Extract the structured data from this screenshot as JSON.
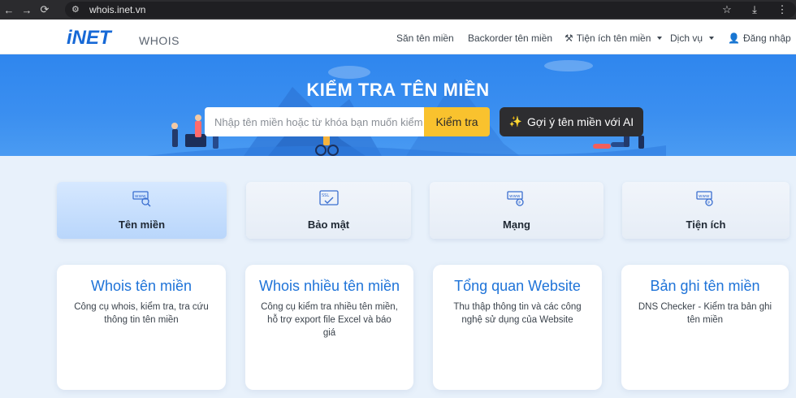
{
  "browser": {
    "url": "whois.inet.vn",
    "back_icon": "arrow-left-icon",
    "forward_icon": "arrow-right-icon",
    "reload_icon": "reload-icon",
    "star_icon": "star-icon",
    "download_icon": "download-icon",
    "menu_icon": "kebab-menu-icon"
  },
  "header": {
    "logo": "iNET",
    "logo_sub": "WHOIS",
    "nav": {
      "san_ten_mien": "Săn tên miền",
      "backorder": "Backorder tên miền",
      "tien_ich": "Tiện ích tên miền",
      "dich_vu": "Dịch vụ",
      "dang_nhap": "Đăng nhập"
    }
  },
  "banner": {
    "title": "KIỂM TRA TÊN MIỀN",
    "search_placeholder": "Nhập tên miền hoặc từ khóa bạn muốn kiểm tra",
    "search_button": "Kiểm tra",
    "ai_button": "Gợi ý tên miền với AI"
  },
  "categories": [
    {
      "label": "Tên miền",
      "icon": "www-search-icon",
      "active": true
    },
    {
      "label": "Bảo mật",
      "icon": "ssl-icon",
      "active": false
    },
    {
      "label": "Mạng",
      "icon": "www-ip-icon",
      "active": false
    },
    {
      "label": "Tiện ích",
      "icon": "www-ip-icon",
      "active": false
    }
  ],
  "cards": [
    {
      "title": "Whois tên miền",
      "desc": "Công cụ whois, kiểm tra, tra cứu thông tin tên miền"
    },
    {
      "title": "Whois nhiều tên miền",
      "desc": "Công cụ kiểm tra nhiều tên miền, hỗ trợ export file Excel và báo giá"
    },
    {
      "title": "Tổng quan Website",
      "desc": "Thu thập thông tin và các công nghệ sử dụng của Website"
    },
    {
      "title": "Bản ghi tên miền",
      "desc": "DNS Checker - Kiểm tra bản ghi tên miền"
    }
  ],
  "colors": {
    "brand_blue": "#1769d6",
    "banner_blue": "#2f86ee",
    "search_yellow": "#f9c22e",
    "ai_dark": "#2d2d30",
    "card_title_blue": "#1e73d8"
  }
}
